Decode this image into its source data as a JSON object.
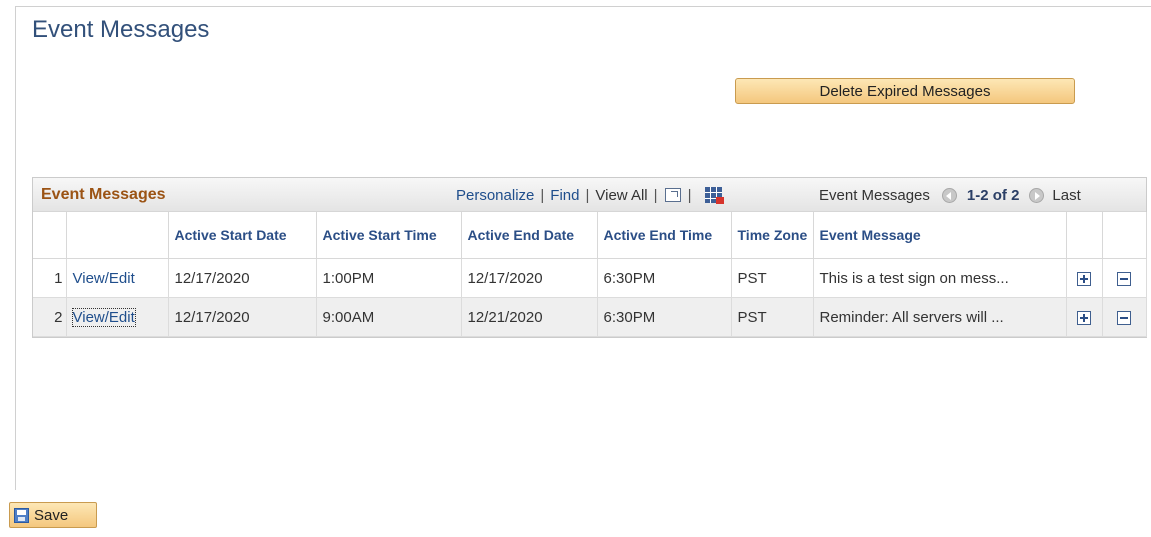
{
  "page": {
    "title": "Event Messages"
  },
  "actions": {
    "delete_expired_label": "Delete Expired Messages",
    "save_label": "Save"
  },
  "grid": {
    "title": "Event Messages",
    "nav": {
      "personalize": "Personalize",
      "find": "Find",
      "view_all": "View All"
    },
    "pager": {
      "label": "Event Messages",
      "range": "1-2 of 2",
      "last": "Last"
    },
    "columns": [
      "Active Start Date",
      "Active Start Time",
      "Active End Date",
      "Active End Time",
      "Time Zone",
      "Event Message"
    ],
    "rows": [
      {
        "num": "1",
        "link": "View/Edit",
        "start_date": "12/17/2020",
        "start_time": "1:00PM",
        "end_date": "12/17/2020",
        "end_time": "6:30PM",
        "tz": "PST",
        "message": "This is a test sign on mess..."
      },
      {
        "num": "2",
        "link": "View/Edit",
        "start_date": "12/17/2020",
        "start_time": "9:00AM",
        "end_date": "12/21/2020",
        "end_time": "6:30PM",
        "tz": "PST",
        "message": "Reminder: All servers will ..."
      }
    ]
  },
  "icons": {
    "zoom": "zoom-icon",
    "download": "grid-download-icon",
    "prev": "circle-left-arrow-icon",
    "next": "circle-right-arrow-icon",
    "add": "plus-icon",
    "delete": "minus-icon",
    "save": "save-disk-icon"
  },
  "colors": {
    "title": "#32507a",
    "grid_title": "#9b5314",
    "link": "#1f4e8c",
    "button_top": "#fde7b5",
    "button_bottom": "#f4c77e"
  }
}
